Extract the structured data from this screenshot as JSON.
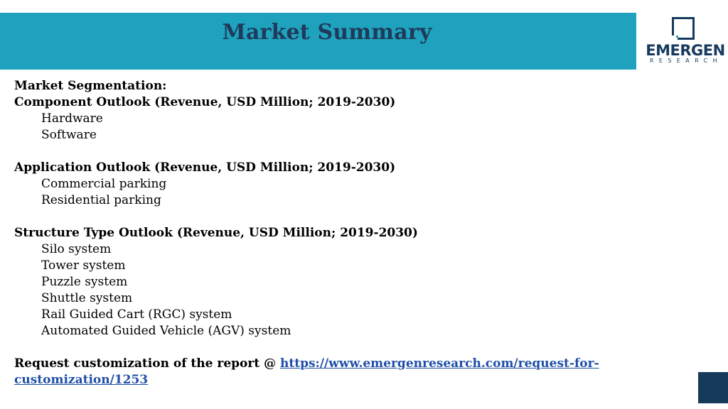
{
  "header": {
    "title": "Market Summary",
    "band_color": "#1fa2bd"
  },
  "logo": {
    "word": "EMERGEN",
    "sub": "RESEARCH"
  },
  "segmentation": {
    "heading": "Market Segmentation:",
    "component": {
      "title": "Component Outlook (Revenue, USD Million; 2019-2030)",
      "items": [
        "Hardware",
        "Software"
      ]
    },
    "application": {
      "title": "Application Outlook (Revenue, USD Million; 2019-2030)",
      "items": [
        "Commercial parking",
        "Residential parking"
      ]
    },
    "structure": {
      "title": "Structure Type Outlook (Revenue, USD Million; 2019-2030)",
      "items": [
        "Silo system",
        "Tower system",
        "Puzzle system",
        "Shuttle system",
        "Rail Guided Cart (RGC) system",
        "Automated Guided Vehicle (AGV) system"
      ]
    }
  },
  "request": {
    "prefix": "Request customization of the report @ ",
    "link_line1": "https://www.emergenresearch.com/request-for-",
    "link_line2": "customization/1253"
  },
  "colors": {
    "title": "#1f3a5a",
    "link": "#1f4fa8",
    "corner": "#163a59"
  }
}
